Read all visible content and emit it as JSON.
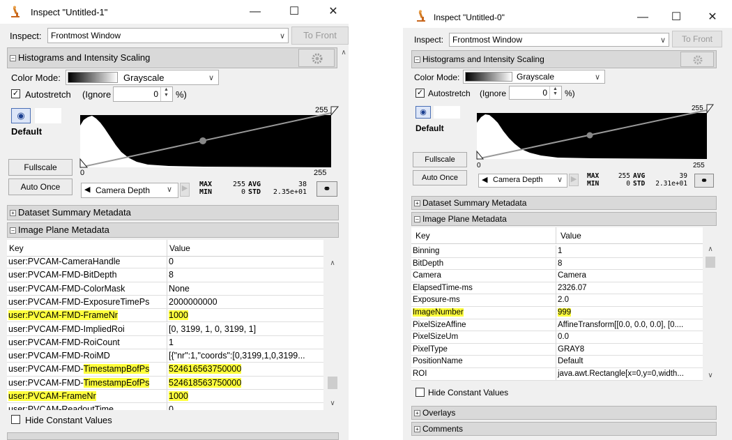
{
  "left": {
    "title": "Inspect \"Untitled-1\"",
    "inspect_label": "Inspect:",
    "inspect_value": "Frontmost Window",
    "to_front": "To Front",
    "histo_title": "Histograms and Intensity Scaling",
    "color_mode_label": "Color Mode:",
    "color_mode_value": "Grayscale",
    "autostretch_label": "Autostretch",
    "ignore_label": "(Ignore",
    "ignore_value": "0",
    "percent_label": "%)",
    "channel_name": "Default",
    "hist_max_tick": "255",
    "hist_min_tick": "0",
    "hist_axis_max": "255",
    "fullscale_label": "Fullscale",
    "auto_once_label": "Auto Once",
    "camera_depth": "Camera Depth",
    "max_label": "MAX",
    "max_value": "255",
    "min_label": "MIN",
    "min_value": "0",
    "avg_label": "AVG",
    "avg_value": "38",
    "std_label": "STD",
    "std_value": "2.35e+01",
    "dataset_summary": "Dataset Summary Metadata",
    "image_plane": "Image Plane Metadata",
    "col_key": "Key",
    "col_value": "Value",
    "rows": [
      {
        "key": "user:PVCAM-CameraHandle",
        "value": "0",
        "hk": false,
        "hv": false
      },
      {
        "key": "user:PVCAM-FMD-BitDepth",
        "value": "8",
        "hk": false,
        "hv": false
      },
      {
        "key": "user:PVCAM-FMD-ColorMask",
        "value": "None",
        "hk": false,
        "hv": false
      },
      {
        "key": "user:PVCAM-FMD-ExposureTimePs",
        "value": "2000000000",
        "hk": false,
        "hv": false
      },
      {
        "key": "user:PVCAM-FMD-FrameNr",
        "value": "1000",
        "hk": true,
        "hv": true
      },
      {
        "key": "user:PVCAM-FMD-ImpliedRoi",
        "value": "[0, 3199, 1, 0, 3199, 1]",
        "hk": false,
        "hv": false
      },
      {
        "key": "user:PVCAM-FMD-RoiCount",
        "value": "1",
        "hk": false,
        "hv": false
      },
      {
        "key": "user:PVCAM-FMD-RoiMD",
        "value": "[{\"nr\":1,\"coords\":[0,3199,1,0,3199...",
        "hk": false,
        "hv": false
      },
      {
        "key": "user:PVCAM-FMD-TimestampBofPs",
        "key_prefix": "user:PVCAM-FMD-",
        "key_hl": "TimestampBofPs",
        "value": "524616563750000",
        "hk": "partial",
        "hv": true
      },
      {
        "key": "user:PVCAM-FMD-TimestampEofPs",
        "key_prefix": "user:PVCAM-FMD-",
        "key_hl": "TimestampEofPs",
        "value": "524618563750000",
        "hk": "partial",
        "hv": true
      },
      {
        "key": "user:PVCAM-FrameNr",
        "value": "1000",
        "hk": true,
        "hv": true
      },
      {
        "key": "user:PVCAM-ReadoutTime",
        "value": "0",
        "hk": false,
        "hv": false
      }
    ],
    "hide_constant": "Hide Constant Values"
  },
  "right": {
    "title": "Inspect \"Untitled-0\"",
    "inspect_label": "Inspect:",
    "inspect_value": "Frontmost Window",
    "to_front": "To Front",
    "histo_title": "Histograms and Intensity Scaling",
    "color_mode_label": "Color Mode:",
    "color_mode_value": "Grayscale",
    "autostretch_label": "Autostretch",
    "ignore_label": "(Ignore",
    "ignore_value": "0",
    "percent_label": "%)",
    "channel_name": "Default",
    "hist_max_tick": "255",
    "hist_min_tick": "0",
    "hist_axis_max": "255",
    "fullscale_label": "Fullscale",
    "auto_once_label": "Auto Once",
    "camera_depth": "Camera Depth",
    "max_label": "MAX",
    "max_value": "255",
    "min_label": "MIN",
    "min_value": "0",
    "avg_label": "AVG",
    "avg_value": "39",
    "std_label": "STD",
    "std_value": "2.31e+01",
    "dataset_summary": "Dataset Summary Metadata",
    "image_plane": "Image Plane Metadata",
    "col_key": "Key",
    "col_value": "Value",
    "rows": [
      {
        "key": "Binning",
        "value": "1",
        "hk": false,
        "hv": false
      },
      {
        "key": "BitDepth",
        "value": "8",
        "hk": false,
        "hv": false
      },
      {
        "key": "Camera",
        "value": "Camera",
        "hk": false,
        "hv": false
      },
      {
        "key": "ElapsedTime-ms",
        "value": "2326.07",
        "hk": false,
        "hv": false
      },
      {
        "key": "Exposure-ms",
        "value": "2.0",
        "hk": false,
        "hv": false
      },
      {
        "key": "ImageNumber",
        "value": "999",
        "hk": true,
        "hv": true
      },
      {
        "key": "PixelSizeAffine",
        "value": "AffineTransform[[0.0, 0.0, 0.0], [0....",
        "hk": false,
        "hv": false
      },
      {
        "key": "PixelSizeUm",
        "value": "0.0",
        "hk": false,
        "hv": false
      },
      {
        "key": "PixelType",
        "value": "GRAY8",
        "hk": false,
        "hv": false
      },
      {
        "key": "PositionName",
        "value": "Default",
        "hk": false,
        "hv": false
      },
      {
        "key": "ROI",
        "value": "java.awt.Rectangle[x=0,y=0,width...",
        "hk": false,
        "hv": false
      }
    ],
    "hide_constant": "Hide Constant Values",
    "overlays": "Overlays",
    "comments": "Comments"
  }
}
